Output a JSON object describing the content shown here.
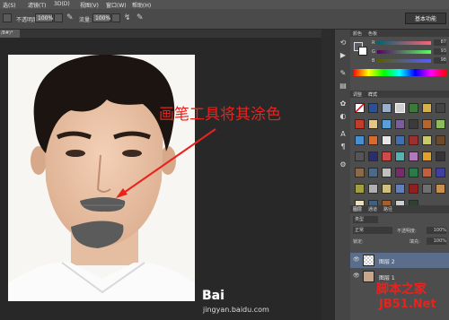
{
  "menubar": {
    "items": [
      "选(S)",
      "滤镜(T)",
      "3D(D)",
      "视图(V)",
      "窗口(W)",
      "帮助(H)"
    ]
  },
  "options": {
    "opacity_label": "不透明度:",
    "opacity_value": "100%",
    "flow_label": "流量:",
    "flow_value": "100%",
    "workspace_label": "基本功能"
  },
  "document": {
    "tab_label": "/8#)*"
  },
  "color_panel": {
    "tabs": [
      "颜色",
      "色板"
    ],
    "r_label": "R",
    "r_value": "87",
    "g_label": "G",
    "g_value": "93",
    "b_label": "B",
    "b_value": "98"
  },
  "style_panel": {
    "tabs": [
      "调整",
      "样式"
    ]
  },
  "layers_panel": {
    "tabs": [
      "图层",
      "通道",
      "路径"
    ],
    "kind_label": "类型",
    "blend_mode": "正常",
    "opacity_label": "不透明度:",
    "opacity_value": "100%",
    "lock_label": "锁定:",
    "fill_label": "填充:",
    "fill_value": "100%",
    "layer1_name": "图层 2",
    "layer2_name": "图层 1"
  },
  "annotation": {
    "text": "画笔工具将其涂色",
    "color": "#e8231e"
  },
  "watermark": {
    "baidu": "Bai",
    "jingyan": "jingyan.baidu.com",
    "site_cn": "脚本之家",
    "site_url": "JB51.Net"
  },
  "colors": {
    "accent_red": "#e8231e",
    "paint_gray": "#5b5b5b",
    "foreground": "#575d62"
  }
}
